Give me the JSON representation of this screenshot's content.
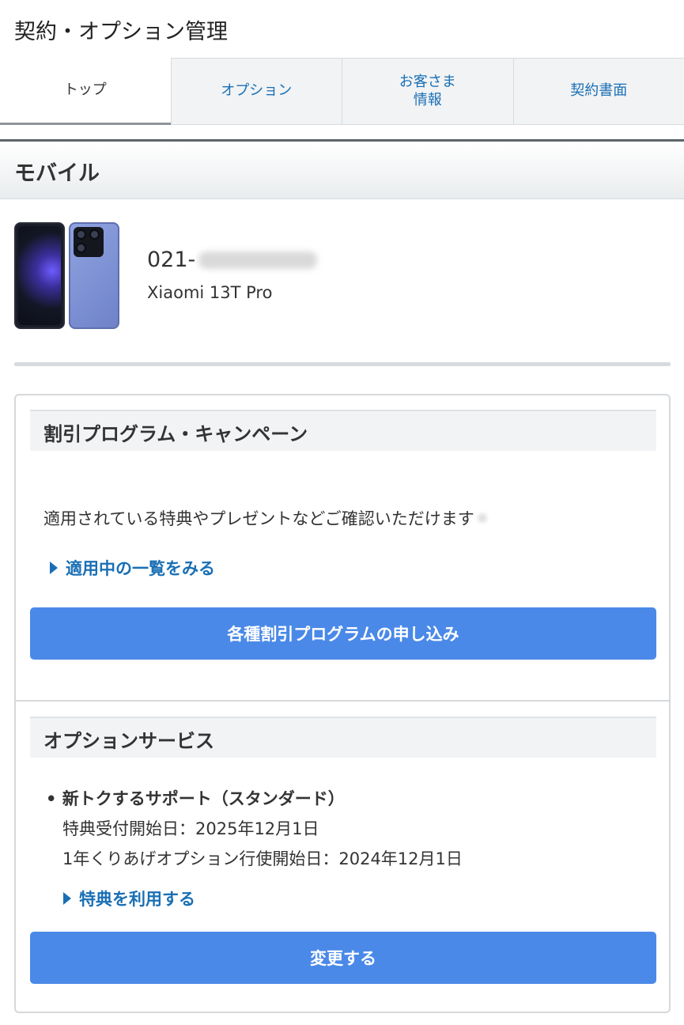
{
  "page": {
    "title": "契約・オプション管理"
  },
  "tabs": [
    {
      "label": "トップ",
      "active": true
    },
    {
      "label": "オプション",
      "active": false
    },
    {
      "label": "お客さま\n情報",
      "active": false
    },
    {
      "label": "契約書面",
      "active": false
    }
  ],
  "section": {
    "title": "モバイル"
  },
  "device": {
    "phone_number_prefix": "021-",
    "phone_number_masked": true,
    "model": "Xiaomi 13T Pro"
  },
  "discount": {
    "title": "割引プログラム・キャンペーン",
    "description": "適用されている特典やプレゼントなどご確認いただけます",
    "link_label": "適用中の一覧をみる",
    "button_label": "各種割引プログラムの申し込み"
  },
  "options": {
    "title": "オプションサービス",
    "item_name": "• 新トクするサポート（スタンダード）",
    "detail_1": "特典受付開始日：2025年12月1日",
    "detail_2": "1年くりあげオプション行使開始日：2024年12月1日",
    "link_label": "特典を利用する",
    "button_label": "変更する"
  },
  "colors": {
    "link": "#1a6fb4",
    "button": "#4a89e8",
    "header_bar": "#5b646b"
  },
  "icons": {
    "link_arrow": "right-triangle-icon"
  }
}
